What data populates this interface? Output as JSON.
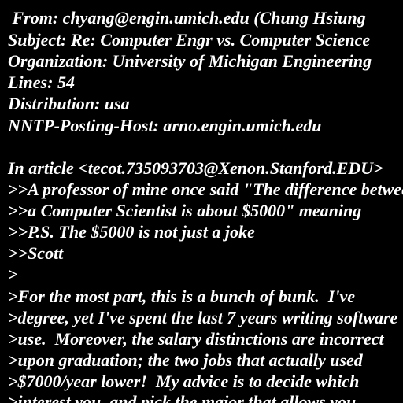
{
  "colors": {
    "background": "#000000",
    "text": "#ffffff"
  },
  "lines": [
    " From: chyang@engin.umich.edu (Chung Hsiung",
    "Subject: Re: Computer Engr vs. Computer Science",
    "Organization: University of Michigan Engineering",
    "Lines: 54",
    "Distribution: usa",
    "NNTP-Posting-Host: arno.engin.umich.edu",
    "",
    "In article <tecot.735093703@Xenon.Stanford.EDU>",
    ">>A professor of mine once said \"The difference between",
    ">>a Computer Scientist is about $5000\" meaning",
    ">>P.S. The $5000 is not just a joke",
    ">>Scott",
    ">",
    ">For the most part, this is a bunch of bunk.  I've",
    ">degree, yet I've spent the last 7 years writing software",
    ">use.  Moreover, the salary distinctions are incorrect",
    ">upon graduation; the two jobs that actually used",
    ">$7000/year lower!  My advice is to decide which",
    ">interest you, and pick the major that allows you"
  ]
}
